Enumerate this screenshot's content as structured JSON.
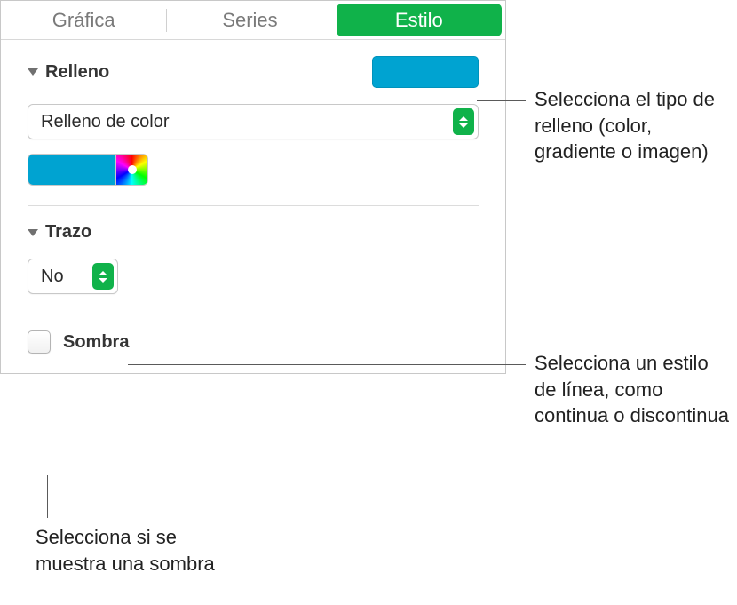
{
  "tabs": {
    "grafica": "Gráfica",
    "series": "Series",
    "estilo": "Estilo"
  },
  "fill": {
    "title": "Relleno",
    "type_label": "Relleno de color",
    "color": "#00a3d1"
  },
  "stroke": {
    "title": "Trazo",
    "value": "No"
  },
  "shadow": {
    "label": "Sombra"
  },
  "callouts": {
    "fill": "Selecciona el tipo de relleno (color, gradiente o imagen)",
    "stroke": "Selecciona un estilo de línea, como continua o discontinua",
    "shadow": "Selecciona si se muestra una sombra"
  }
}
